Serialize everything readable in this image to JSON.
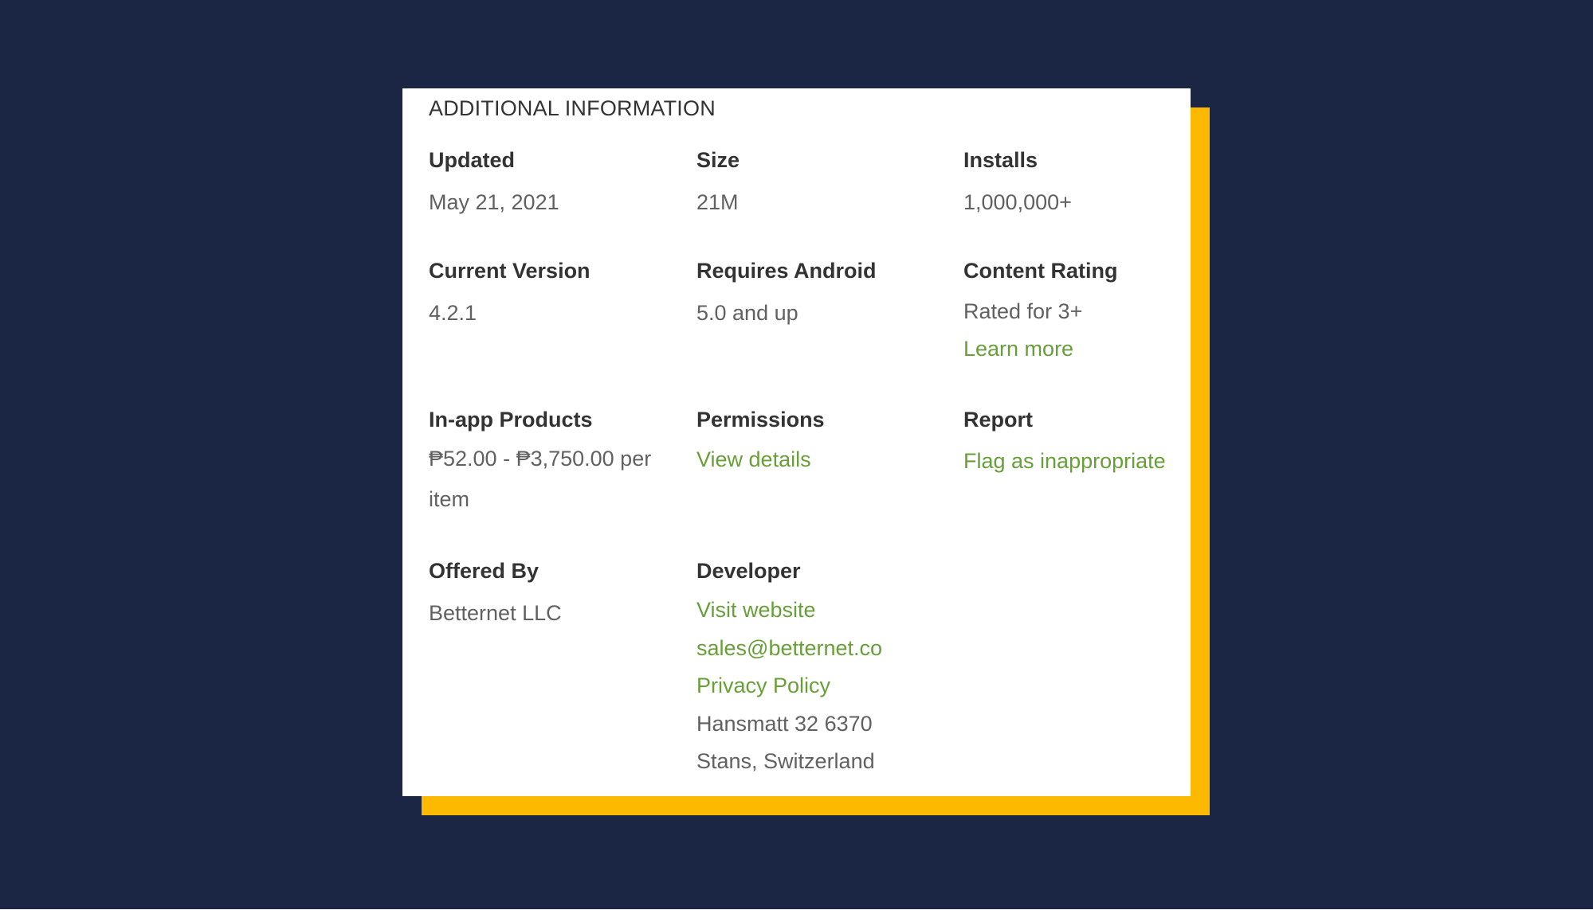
{
  "section_title": "ADDITIONAL INFORMATION",
  "colors": {
    "background": "#1b2644",
    "accent_block": "#fcb900",
    "card": "#ffffff",
    "link": "#689f38"
  },
  "fields": {
    "updated": {
      "label": "Updated",
      "value": "May 21, 2021"
    },
    "size": {
      "label": "Size",
      "value": "21M"
    },
    "installs": {
      "label": "Installs",
      "value": "1,000,000+"
    },
    "current_version": {
      "label": "Current Version",
      "value": "4.2.1"
    },
    "requires_android": {
      "label": "Requires Android",
      "value": "5.0 and up"
    },
    "content_rating": {
      "label": "Content Rating",
      "value": "Rated for 3+",
      "link": "Learn more"
    },
    "in_app_products": {
      "label": "In-app Products",
      "value": "₱52.00 - ₱3,750.00 per item"
    },
    "permissions": {
      "label": "Permissions",
      "link": "View details"
    },
    "report": {
      "label": "Report",
      "link": "Flag as inappropriate"
    },
    "offered_by": {
      "label": "Offered By",
      "value": "Betternet LLC"
    },
    "developer": {
      "label": "Developer",
      "website_link": "Visit website",
      "email_link": "sales@betternet.co",
      "privacy_link": "Privacy Policy",
      "address_line1": "Hansmatt 32 6370",
      "address_line2": "Stans, Switzerland"
    }
  }
}
